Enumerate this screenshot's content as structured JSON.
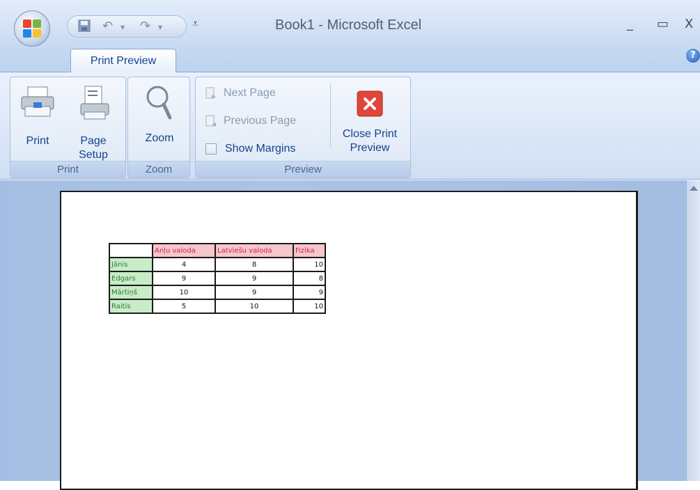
{
  "window": {
    "title": "Book1 - Microsoft Excel",
    "minimize": "_",
    "maximize": "▭",
    "close": "X"
  },
  "tabs": [
    {
      "label": "Print Preview",
      "active": true
    }
  ],
  "ribbon": {
    "groups": [
      {
        "label": "Print",
        "buttons": [
          "Print",
          "Page Setup"
        ]
      },
      {
        "label": "Zoom",
        "buttons": [
          "Zoom"
        ]
      },
      {
        "label": "Preview",
        "buttons": [
          "Next Page",
          "Previous Page",
          "Show Margins",
          "Close Print Preview"
        ]
      }
    ],
    "print_label": "Print",
    "page_setup_line1": "Page",
    "page_setup_line2": "Setup",
    "zoom_label": "Zoom",
    "next_page": "Next Page",
    "previous_page": "Previous Page",
    "show_margins": "Show Margins",
    "close_line1": "Close Print",
    "close_line2": "Preview",
    "show_margins_checked": false
  },
  "sheet": {
    "headers": [
      "",
      "Anļu valoda",
      "Latviešu valoda",
      "Fizika"
    ],
    "rows": [
      {
        "name": "Jānis",
        "values": [
          "4",
          "8",
          "10"
        ]
      },
      {
        "name": "Edgars",
        "values": [
          "9",
          "9",
          "8"
        ]
      },
      {
        "name": "Mārtiņš",
        "values": [
          "10",
          "9",
          "9"
        ]
      },
      {
        "name": "Raitis",
        "values": [
          "5",
          "10",
          "10"
        ]
      }
    ]
  },
  "colors": {
    "header_bg": "#f5c6cb",
    "header_text": "#d0204a",
    "name_bg": "#c8ecc8",
    "name_text": "#2b7d3b",
    "ribbon_text": "#15428b"
  }
}
